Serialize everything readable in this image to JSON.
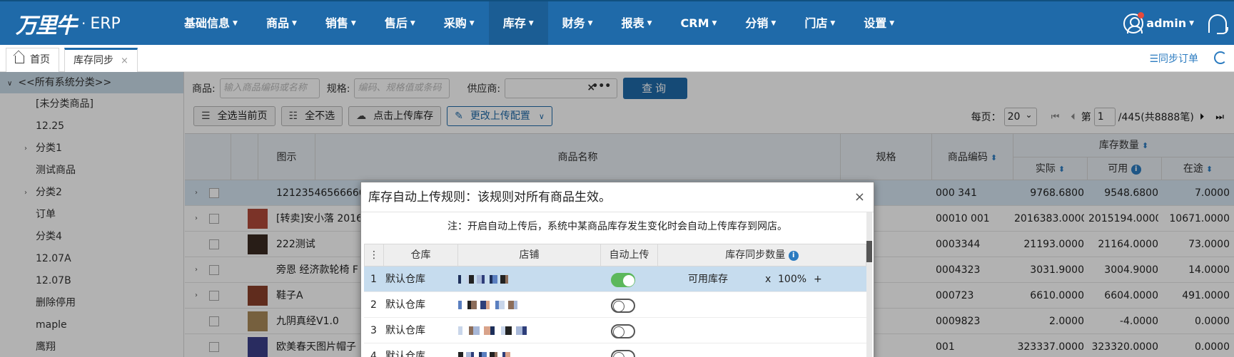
{
  "app": {
    "brand": "万里牛",
    "dot": "·",
    "product": "ERP"
  },
  "nav": {
    "items": [
      "基础信息",
      "商品",
      "销售",
      "售后",
      "采购",
      "库存",
      "财务",
      "报表",
      "CRM",
      "分销",
      "门店",
      "设置"
    ],
    "active_index": 5,
    "user": "admin"
  },
  "tabs": {
    "home": "首页",
    "active": "库存同步",
    "close": "×"
  },
  "toolbar_right": {
    "sync_order": "☰同步订单"
  },
  "sidebar": {
    "root": "<<所有系统分类>>",
    "items": [
      {
        "label": "[未分类商品]",
        "expandable": false
      },
      {
        "label": "12.25",
        "expandable": false
      },
      {
        "label": "分类1",
        "expandable": true
      },
      {
        "label": "测试商品",
        "expandable": false
      },
      {
        "label": "分类2",
        "expandable": true
      },
      {
        "label": "订单",
        "expandable": false
      },
      {
        "label": "分类4",
        "expandable": false
      },
      {
        "label": "12.07A",
        "expandable": false
      },
      {
        "label": "12.07B",
        "expandable": false
      },
      {
        "label": "删除停用",
        "expandable": false
      },
      {
        "label": "maple",
        "expandable": false
      },
      {
        "label": "鹰翔",
        "expandable": false
      }
    ]
  },
  "filters": {
    "product_label": "商品:",
    "product_placeholder": "输入商品编码或名称",
    "spec_label": "规格:",
    "spec_placeholder": "编码、规格值或条码",
    "supplier_label": "供应商:",
    "supplier_clear": "×",
    "supplier_more": "•••",
    "query_button": "查询"
  },
  "actions": {
    "select_page": "全选当前页",
    "deselect_all": "全不选",
    "upload_stock": "点击上传库存",
    "change_upload_config": "更改上传配置"
  },
  "pager": {
    "per_page_label": "每页：",
    "per_page": "20",
    "page_label": "第",
    "page": "1",
    "total": "/445(共8888笔)"
  },
  "grid": {
    "headers": {
      "image": "图示",
      "name": "商品名称",
      "spec": "规格",
      "code": "商品编码",
      "stock": "库存数量",
      "actual": "实际",
      "available": "可用",
      "transit": "在途"
    },
    "rows": [
      {
        "expandable": true,
        "thumb": "",
        "name": "12123546566666",
        "code": "000 341",
        "actual": "9768.6800",
        "available": "9548.6800",
        "transit": "7.0000"
      },
      {
        "expandable": true,
        "thumb": "#b04a3a",
        "name": "[转卖]安小落 2016",
        "code": "00010 001",
        "actual": "2016383.0000",
        "available": "2015194.0000",
        "transit": "10671.0000"
      },
      {
        "expandable": false,
        "thumb": "#3a2a22",
        "name": "222测试",
        "code": "0003344",
        "actual": "21193.0000",
        "available": "21164.0000",
        "transit": "73.0000"
      },
      {
        "expandable": true,
        "thumb": "",
        "name": "旁恩 经济款轮椅 F",
        "code": "0004323",
        "actual": "3031.9000",
        "available": "3004.9000",
        "transit": "14.0000"
      },
      {
        "expandable": true,
        "thumb": "#8a3f2a",
        "name": "鞋子A",
        "code": "000723",
        "actual": "6610.0000",
        "available": "6604.0000",
        "transit": "491.0000"
      },
      {
        "expandable": false,
        "thumb": "#a98a5a",
        "name": "九阴真经V1.0",
        "code": "0009823",
        "actual": "2.0000",
        "available": "-4.0000",
        "transit": "0.0000"
      },
      {
        "expandable": false,
        "thumb": "#3b3f8a",
        "name": "欧美春天图片帽子",
        "code": "001",
        "actual": "323337.0000",
        "available": "323320.0000",
        "transit": "0.0000"
      }
    ]
  },
  "modal": {
    "title": "库存自动上传规则：该规则对所有商品生效。",
    "close": "×",
    "note": "注：开启自动上传后，系统中某商品库存发生变化时会自动上传库存到网店。",
    "headers": {
      "menu": "⋮",
      "warehouse": "仓库",
      "shop": "店铺",
      "auto_upload": "自动上传",
      "sync_qty": "库存同步数量"
    },
    "rows": [
      {
        "no": "1",
        "warehouse": "默认仓库",
        "auto": true,
        "stock_type": "可用库存",
        "times": "x",
        "percent": "100%",
        "plus": "+"
      },
      {
        "no": "2",
        "warehouse": "默认仓库",
        "auto": false,
        "stock_type": "",
        "times": "",
        "percent": "",
        "plus": ""
      },
      {
        "no": "3",
        "warehouse": "默认仓库",
        "auto": false,
        "stock_type": "",
        "times": "",
        "percent": "",
        "plus": ""
      },
      {
        "no": "4",
        "warehouse": "默认仓库",
        "auto": false,
        "stock_type": "",
        "times": "",
        "percent": "",
        "plus": ""
      }
    ]
  },
  "colors": {
    "nav": "#1f6aa9",
    "accent": "#2b7bc0",
    "toggle_on": "#5cb85c",
    "selected_row": "#c6dcee"
  }
}
